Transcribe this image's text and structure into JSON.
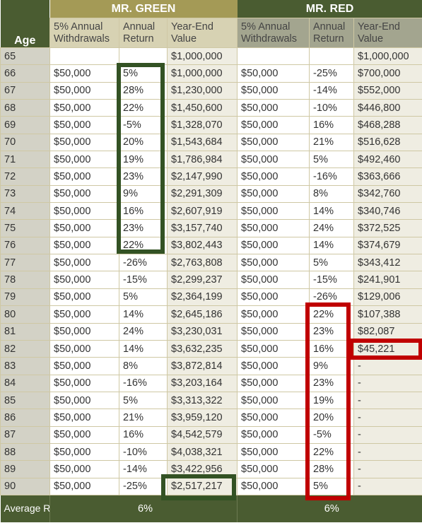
{
  "header": {
    "age": "Age",
    "green": "MR. GREEN",
    "red": "MR. RED",
    "withdrawals": "5% Annual Withdrawals",
    "return": "Annual Return",
    "value": "Year-End Value"
  },
  "rows": [
    [
      "65",
      "",
      "",
      "$1,000,000",
      "",
      "",
      "$1,000,000"
    ],
    [
      "66",
      "$50,000",
      "5%",
      "$1,000,000",
      "$50,000",
      "-25%",
      "$700,000"
    ],
    [
      "67",
      "$50,000",
      "28%",
      "$1,230,000",
      "$50,000",
      "-14%",
      "$552,000"
    ],
    [
      "68",
      "$50,000",
      "22%",
      "$1,450,600",
      "$50,000",
      "-10%",
      "$446,800"
    ],
    [
      "69",
      "$50,000",
      "-5%",
      "$1,328,070",
      "$50,000",
      "16%",
      "$468,288"
    ],
    [
      "70",
      "$50,000",
      "20%",
      "$1,543,684",
      "$50,000",
      "21%",
      "$516,628"
    ],
    [
      "71",
      "$50,000",
      "19%",
      "$1,786,984",
      "$50,000",
      "5%",
      "$492,460"
    ],
    [
      "72",
      "$50,000",
      "23%",
      "$2,147,990",
      "$50,000",
      "-16%",
      "$363,666"
    ],
    [
      "73",
      "$50,000",
      "9%",
      "$2,291,309",
      "$50,000",
      "8%",
      "$342,760"
    ],
    [
      "74",
      "$50,000",
      "16%",
      "$2,607,919",
      "$50,000",
      "14%",
      "$340,746"
    ],
    [
      "75",
      "$50,000",
      "23%",
      "$3,157,740",
      "$50,000",
      "24%",
      "$372,525"
    ],
    [
      "76",
      "$50,000",
      "22%",
      "$3,802,443",
      "$50,000",
      "14%",
      "$374,679"
    ],
    [
      "77",
      "$50,000",
      "-26%",
      "$2,763,808",
      "$50,000",
      "5%",
      "$343,412"
    ],
    [
      "78",
      "$50,000",
      "-15%",
      "$2,299,237",
      "$50,000",
      "-15%",
      "$241,901"
    ],
    [
      "79",
      "$50,000",
      "5%",
      "$2,364,199",
      "$50,000",
      "-26%",
      "$129,006"
    ],
    [
      "80",
      "$50,000",
      "14%",
      "$2,645,186",
      "$50,000",
      "22%",
      "$107,388"
    ],
    [
      "81",
      "$50,000",
      "24%",
      "$3,230,031",
      "$50,000",
      "23%",
      "$82,087"
    ],
    [
      "82",
      "$50,000",
      "14%",
      "$3,632,235",
      "$50,000",
      "16%",
      "$45,221"
    ],
    [
      "83",
      "$50,000",
      "8%",
      "$3,872,814",
      "$50,000",
      "9%",
      "-"
    ],
    [
      "84",
      "$50,000",
      "-16%",
      "$3,203,164",
      "$50,000",
      "23%",
      "-"
    ],
    [
      "85",
      "$50,000",
      "5%",
      "$3,313,322",
      "$50,000",
      "19%",
      "-"
    ],
    [
      "86",
      "$50,000",
      "21%",
      "$3,959,120",
      "$50,000",
      "20%",
      "-"
    ],
    [
      "87",
      "$50,000",
      "16%",
      "$4,542,579",
      "$50,000",
      "-5%",
      "-"
    ],
    [
      "88",
      "$50,000",
      "-10%",
      "$4,038,321",
      "$50,000",
      "22%",
      "-"
    ],
    [
      "89",
      "$50,000",
      "-14%",
      "$3,422,956",
      "$50,000",
      "28%",
      "-"
    ],
    [
      "90",
      "$50,000",
      "-25%",
      "$2,517,217",
      "$50,000",
      "5%",
      "-"
    ]
  ],
  "footer": {
    "label": "Average Return",
    "green_avg": "6%",
    "red_avg": "6%"
  },
  "colors": {
    "green_highlight": "#335224",
    "red_highlight": "#c00000",
    "green_header": "#a49a56",
    "red_header": "#4a5c31"
  }
}
